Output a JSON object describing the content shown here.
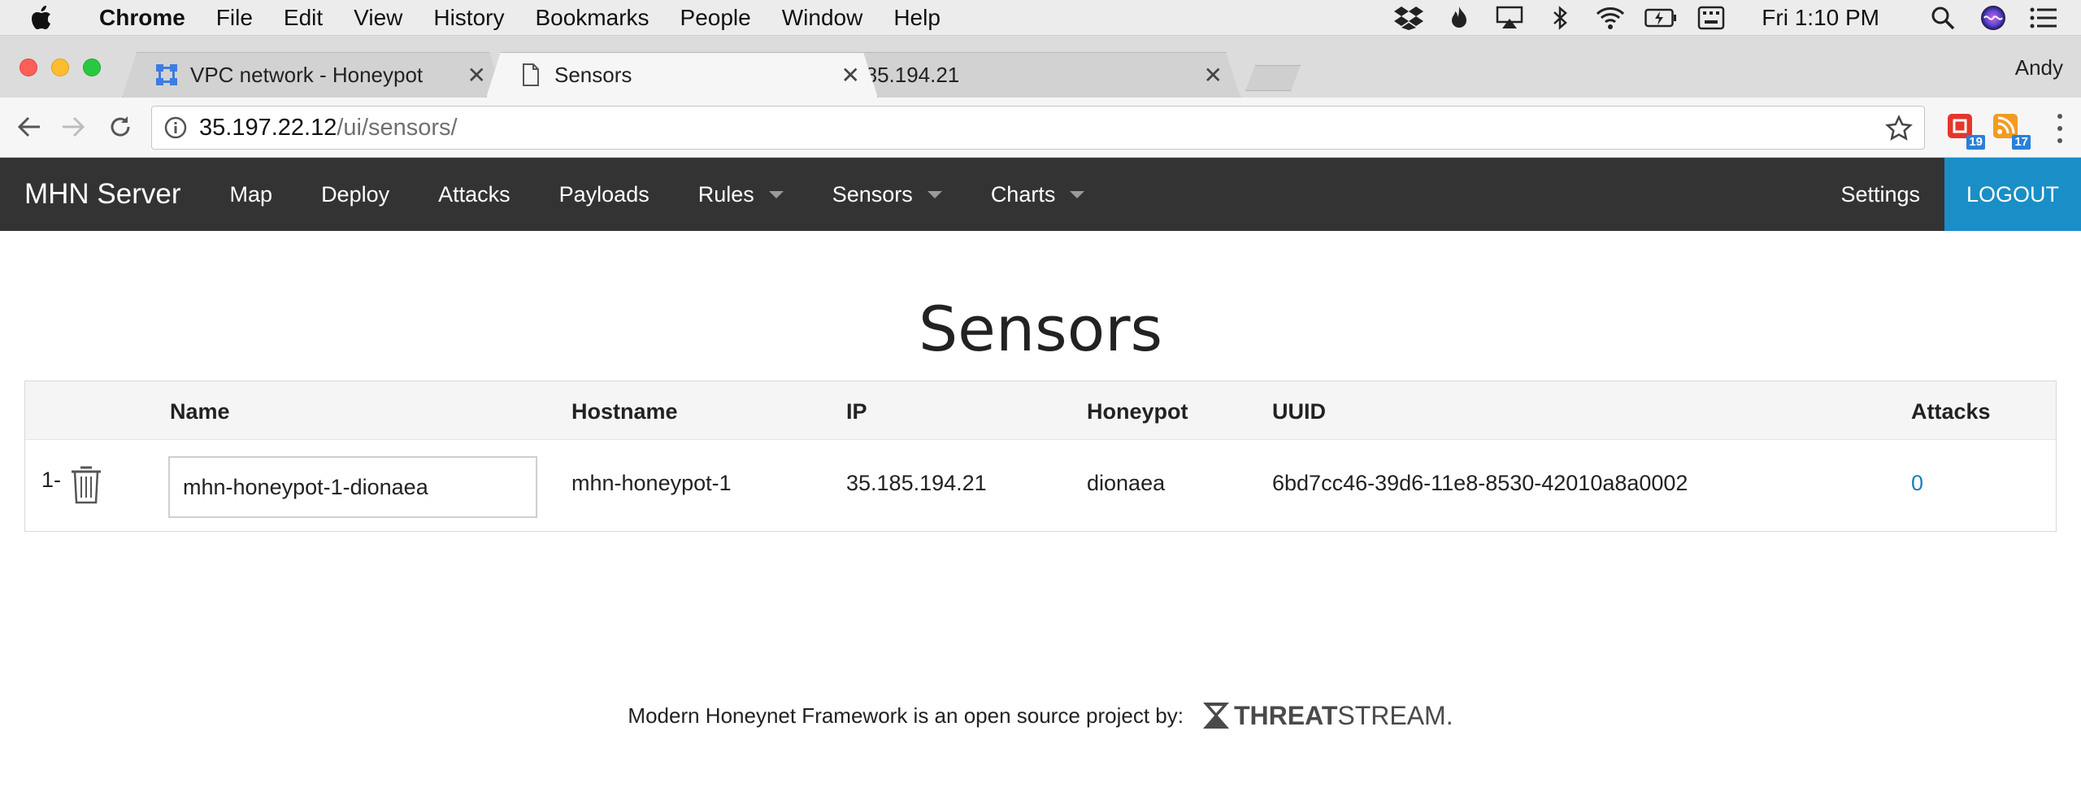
{
  "menubar": {
    "app_name": "Chrome",
    "items": [
      "File",
      "Edit",
      "View",
      "History",
      "Bookmarks",
      "People",
      "Window",
      "Help"
    ],
    "clock": "Fri 1:10 PM"
  },
  "tabs": [
    {
      "title": "VPC network - Honeypot",
      "icon": "vpc-network-icon",
      "active": false
    },
    {
      "title": "Sensors",
      "icon": "page-icon",
      "active": true
    },
    {
      "title": "35.185.194.21",
      "icon": "page-icon",
      "active": false
    }
  ],
  "profile_name": "Andy",
  "omnibox": {
    "host": "35.197.22.12",
    "path": "/ui/sensors/"
  },
  "extensions": [
    {
      "icon": "extension-red-icon",
      "badge": "19"
    },
    {
      "icon": "extension-rss-icon",
      "badge": "17"
    }
  ],
  "navbar": {
    "brand": "MHN Server",
    "links": [
      {
        "label": "Map",
        "dropdown": false
      },
      {
        "label": "Deploy",
        "dropdown": false
      },
      {
        "label": "Attacks",
        "dropdown": false
      },
      {
        "label": "Payloads",
        "dropdown": false
      },
      {
        "label": "Rules",
        "dropdown": true
      },
      {
        "label": "Sensors",
        "dropdown": true
      },
      {
        "label": "Charts",
        "dropdown": true
      }
    ],
    "settings": "Settings",
    "logout": "LOGOUT"
  },
  "page": {
    "title": "Sensors"
  },
  "table": {
    "headers": {
      "name": "Name",
      "hostname": "Hostname",
      "ip": "IP",
      "honeypot": "Honeypot",
      "uuid": "UUID",
      "attacks": "Attacks"
    },
    "rows": [
      {
        "index": "1-",
        "name": "mhn-honeypot-1-dionaea",
        "hostname": "mhn-honeypot-1",
        "ip": "35.185.194.21",
        "honeypot": "dionaea",
        "uuid": "6bd7cc46-39d6-11e8-8530-42010a8a0002",
        "attacks": "0"
      }
    ]
  },
  "footer": {
    "text": "Modern Honeynet Framework is an open source project by:",
    "logo_bold": "THREAT",
    "logo_light": "STREAM."
  },
  "colors": {
    "navbar_bg": "#333333",
    "logout_bg": "#1a8ec7",
    "link": "#1a7fc1"
  }
}
